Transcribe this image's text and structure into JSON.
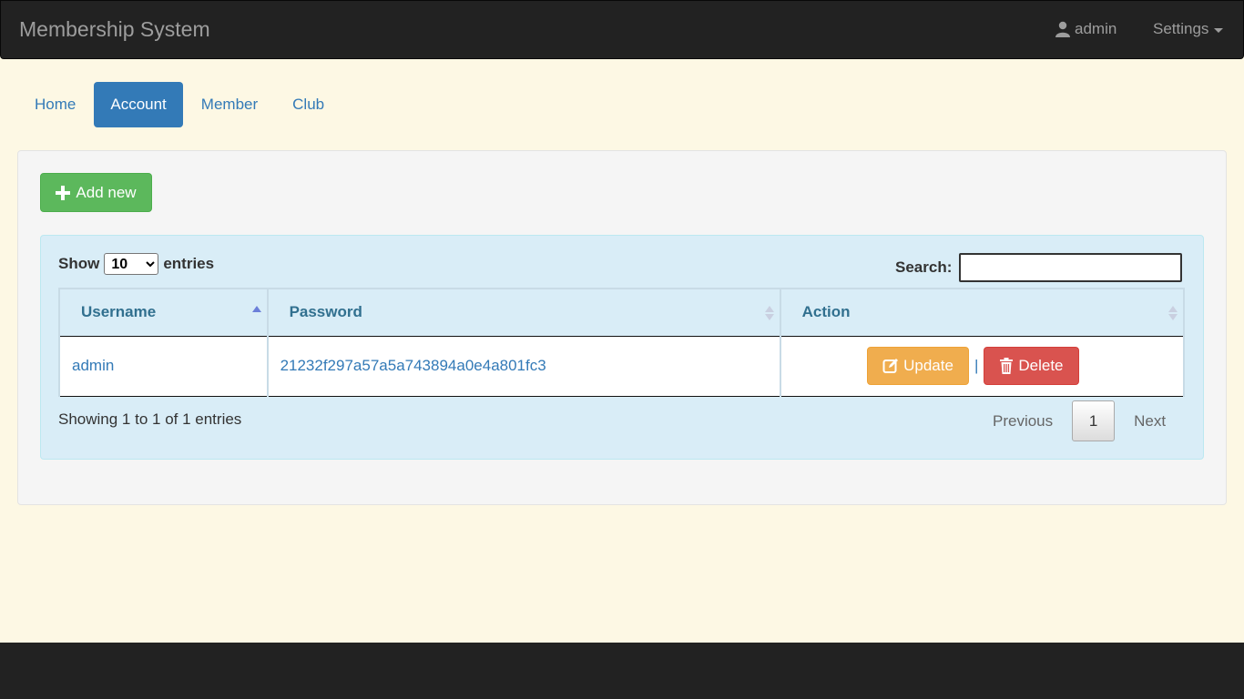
{
  "navbar": {
    "brand": "Membership System",
    "user": "admin",
    "settings": "Settings"
  },
  "tabs": [
    {
      "label": "Home",
      "active": false
    },
    {
      "label": "Account",
      "active": true
    },
    {
      "label": "Member",
      "active": false
    },
    {
      "label": "Club",
      "active": false
    }
  ],
  "toolbar": {
    "add_label": "Add new"
  },
  "table_controls": {
    "show": "Show",
    "entries_value": "10",
    "entries": "entries",
    "search_label": "Search:",
    "search_value": ""
  },
  "table": {
    "columns": [
      "Username",
      "Password",
      "Action"
    ],
    "rows": [
      {
        "username": "admin",
        "password": "21232f297a57a5a743894a0e4a801fc3"
      }
    ],
    "update_label": "Update",
    "separator": "|",
    "delete_label": "Delete"
  },
  "footer_info": "Showing 1 to 1 of 1 entries",
  "pagination": {
    "previous": "Previous",
    "current": "1",
    "next": "Next"
  },
  "colors": {
    "primary": "#337ab7",
    "success": "#5cb85c",
    "warning": "#f0ad4e",
    "danger": "#d9534f",
    "navbar": "#222222",
    "background": "#fdf8e4"
  }
}
